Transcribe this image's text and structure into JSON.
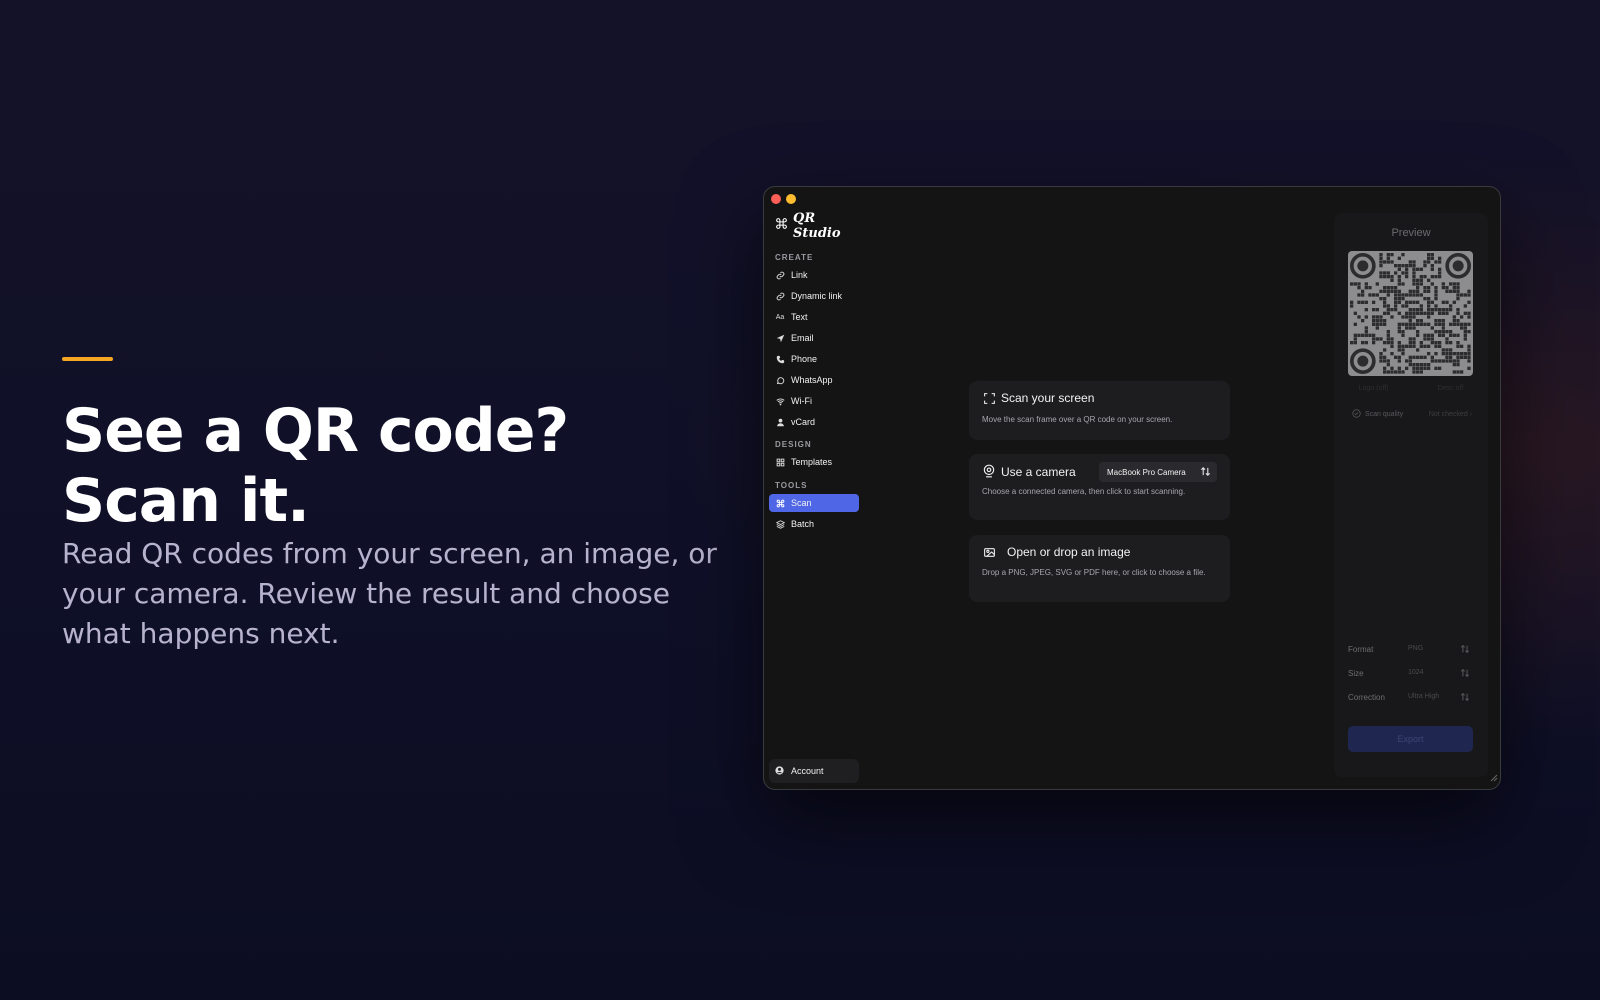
{
  "hero": {
    "headline_line1": "See a QR code?",
    "headline_line2": "Scan it.",
    "subtext": "Read QR codes from your screen, an image, or your camera. Review the result and choose what happens next.",
    "accent_color": "#f5a623"
  },
  "app": {
    "name": "QR Studio",
    "accent_color": "#4f67e6"
  },
  "sidebar": {
    "sections": [
      {
        "label": "CREATE",
        "items": [
          {
            "label": "Link",
            "icon": "link-icon"
          },
          {
            "label": "Dynamic link",
            "icon": "link-icon"
          },
          {
            "label": "Text",
            "icon": "text-icon"
          },
          {
            "label": "Email",
            "icon": "send-icon"
          },
          {
            "label": "Phone",
            "icon": "phone-icon"
          },
          {
            "label": "WhatsApp",
            "icon": "whatsapp-icon"
          },
          {
            "label": "Wi-Fi",
            "icon": "wifi-icon"
          },
          {
            "label": "vCard",
            "icon": "person-icon"
          }
        ]
      },
      {
        "label": "DESIGN",
        "items": [
          {
            "label": "Templates",
            "icon": "grid-icon"
          }
        ]
      },
      {
        "label": "TOOLS",
        "items": [
          {
            "label": "Scan",
            "icon": "scan-icon",
            "active": true
          },
          {
            "label": "Batch",
            "icon": "layers-icon"
          }
        ]
      }
    ],
    "account_label": "Account"
  },
  "scan_options": [
    {
      "title": "Scan your screen",
      "description": "Move the scan frame over a QR code on your screen.",
      "icon": "scan-frame-icon"
    },
    {
      "title": "Use a camera",
      "description": "Choose a connected camera, then click to start scanning.",
      "icon": "camera-icon",
      "camera_selected": "MacBook Pro Camera"
    },
    {
      "title": "Open or drop an image",
      "description": "Drop a PNG, JPEG, SVG or PDF here, or click to choose a file.",
      "icon": "image-icon"
    }
  ],
  "preview": {
    "title": "Preview",
    "ghost_label_left": "Logo (off)",
    "ghost_label_right": "Desc off",
    "quality_label": "Scan quality",
    "quality_status": "Not checked ›",
    "properties": [
      {
        "label": "Format",
        "value": "PNG"
      },
      {
        "label": "Size",
        "value": "1024"
      },
      {
        "label": "Correction",
        "value": "Ultra High"
      }
    ],
    "export_label": "Export"
  }
}
